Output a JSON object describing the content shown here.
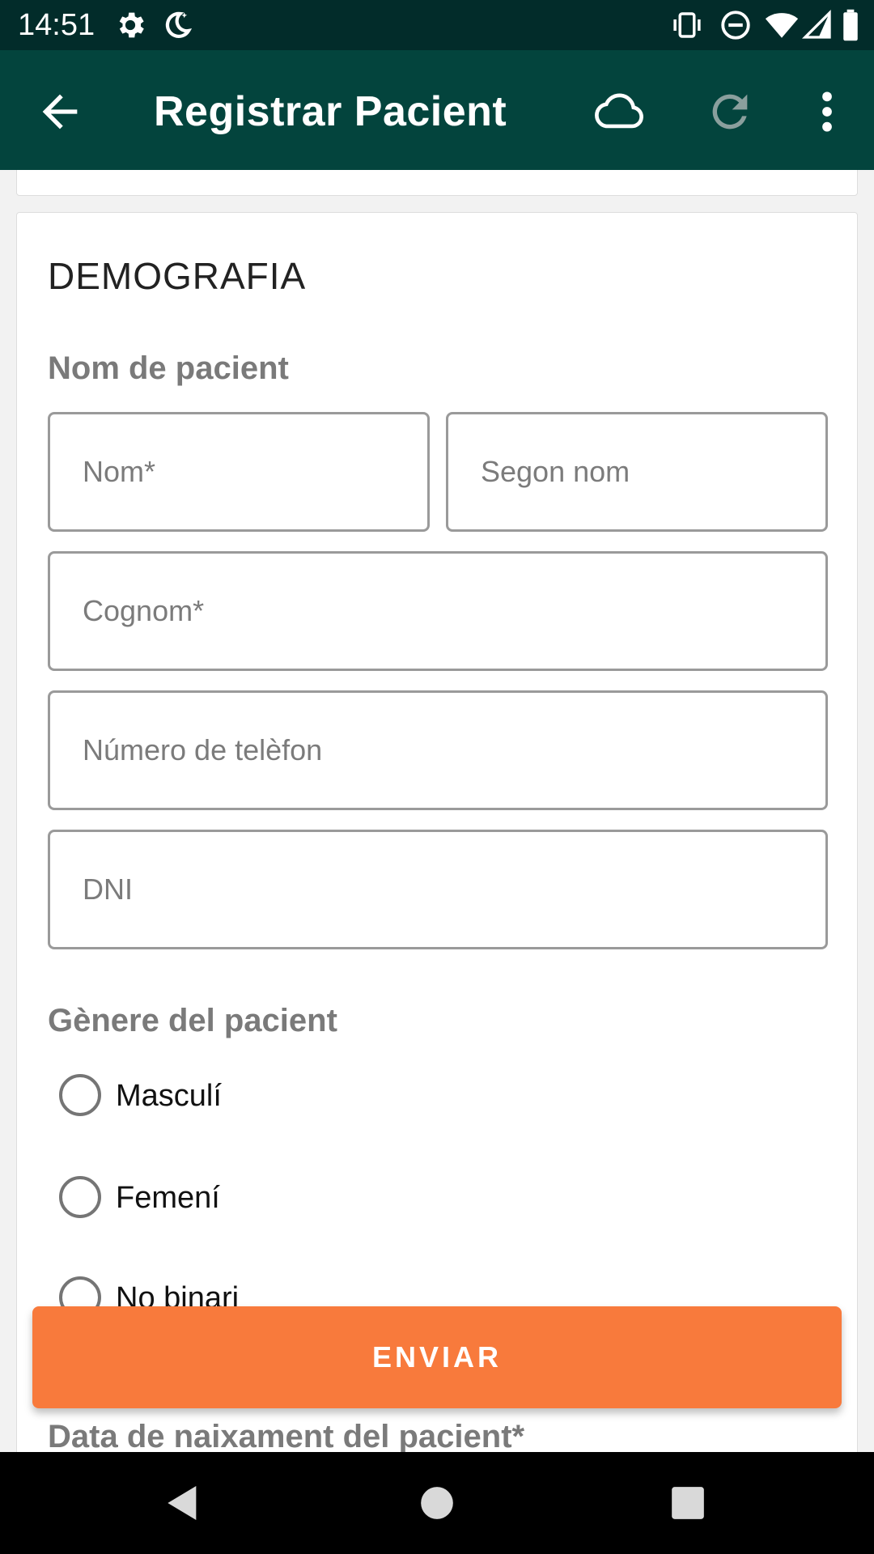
{
  "status_bar": {
    "time": "14:51",
    "left_icons": [
      "gear-icon",
      "night-mode-icon"
    ],
    "right_icons": [
      "vibrate-icon",
      "do-not-disturb-icon",
      "wifi-icon",
      "signal-icon",
      "battery-icon"
    ]
  },
  "app_bar": {
    "title": "Registrar Pacient",
    "back_icon": "arrow-left-icon",
    "actions": [
      "cloud-icon",
      "refresh-icon",
      "more-vert-icon"
    ],
    "background": "#03443d"
  },
  "form": {
    "section_title": "DEMOGRAFIA",
    "name_group_label": "Nom de pacient",
    "fields": {
      "first_name_placeholder": "Nom*",
      "middle_name_placeholder": "Segon nom",
      "last_name_placeholder": "Cognom*",
      "phone_placeholder": "Número de telèfon",
      "dni_placeholder": "DNI"
    },
    "gender_group_label": "Gènere del pacient",
    "gender_options": [
      "Masculí",
      "Femení",
      "No binari"
    ],
    "birth_date_label": "Data de naixament del pacient*"
  },
  "submit": {
    "label": "ENVIAR",
    "color": "#f87a3c"
  },
  "nav_bar": {
    "icons": [
      "back-triangle-icon",
      "home-circle-icon",
      "recents-square-icon"
    ]
  }
}
